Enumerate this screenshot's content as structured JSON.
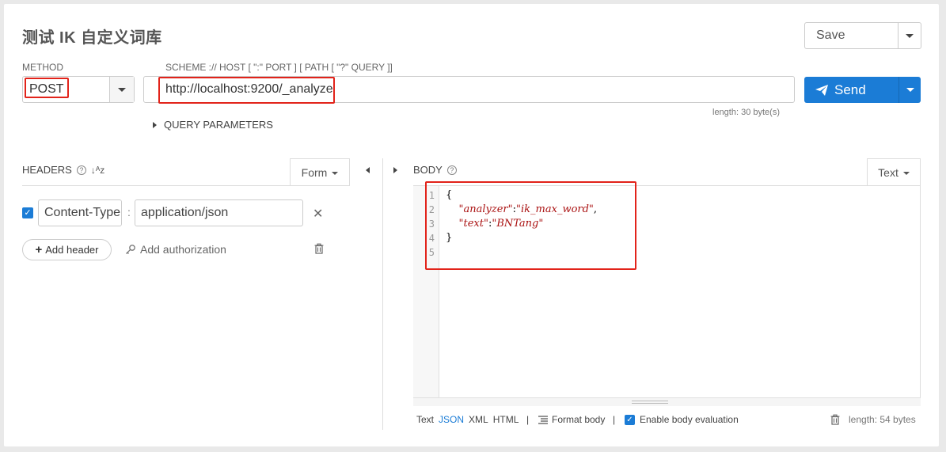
{
  "header": {
    "title": "测试 IK 自定义词库",
    "save_label": "Save"
  },
  "request": {
    "method_label": "METHOD",
    "method_value": "POST",
    "url_label": "SCHEME :// HOST [ \":\" PORT ] [ PATH [ \"?\" QUERY ]]",
    "url_value": "http://localhost:9200/_analyze",
    "url_length": "length: 30 byte(s)",
    "send_label": "Send",
    "query_params_label": "QUERY PARAMETERS"
  },
  "headers_panel": {
    "title": "HEADERS",
    "sort_icon_text": "↓ᴬz",
    "form_label": "Form",
    "items": [
      {
        "enabled": true,
        "name": "Content-Type",
        "separator": ":",
        "value": "application/json"
      }
    ],
    "add_header_label": "Add header",
    "add_authorization_label": "Add authorization"
  },
  "body_panel": {
    "title": "BODY",
    "text_label": "Text",
    "line_numbers": [
      "1",
      "2",
      "3",
      "4",
      "5"
    ],
    "code": {
      "line1": "{",
      "line2_key": "\"analyzer\"",
      "line2_sep": ":",
      "line2_val": "\"ik_max_word\"",
      "line2_end": ",",
      "line3_key": "\"text\"",
      "line3_sep": ":",
      "line3_val": "\"BNTang\"",
      "line4": "}"
    },
    "formats": [
      "Text",
      "JSON",
      "XML",
      "HTML"
    ],
    "active_format": "JSON",
    "separator": "|",
    "format_body_label": "Format body",
    "enable_eval_label": "Enable body evaluation",
    "body_length": "length: 54 bytes"
  },
  "colors": {
    "accent": "#1b7cd6",
    "highlight_box": "#e2231a",
    "string": "#aa1111"
  }
}
